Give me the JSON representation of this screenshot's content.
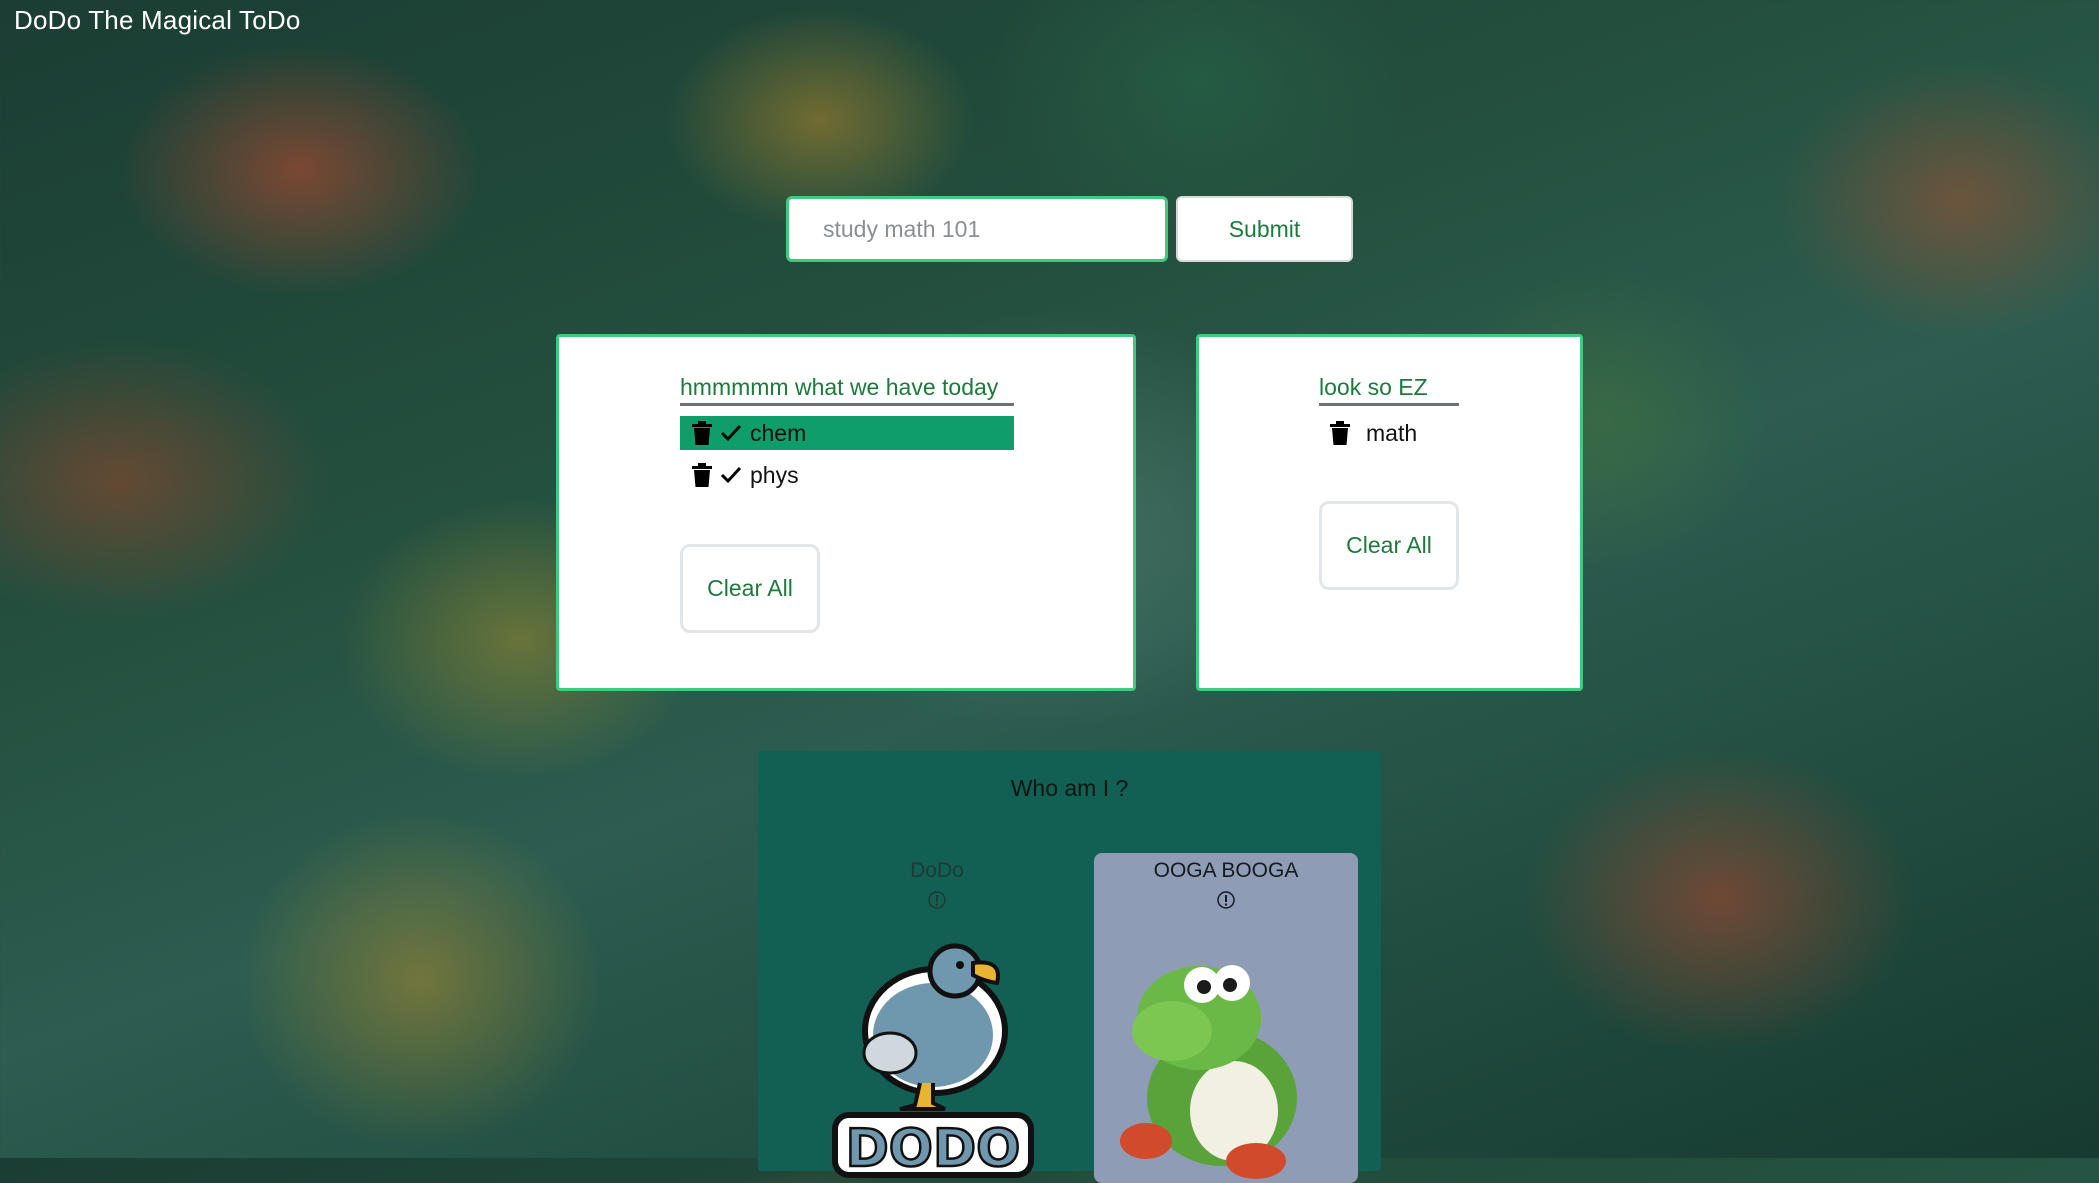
{
  "app": {
    "title": "DoDo The Magical ToDo"
  },
  "form": {
    "input_placeholder": "study math 101",
    "submit_label": "Submit"
  },
  "lists": [
    {
      "heading": "hmmmmm what we have today",
      "items": [
        {
          "text": "chem",
          "highlighted": true
        },
        {
          "text": "phys",
          "highlighted": false
        }
      ],
      "clear_label": "Clear All"
    },
    {
      "heading": "look so EZ",
      "items": [
        {
          "text": "math"
        }
      ],
      "clear_label": "Clear All"
    }
  ],
  "who": {
    "title": "Who am I ?",
    "characters": [
      {
        "name": "DoDo",
        "logo_text": "DODO",
        "icon": "info-icon"
      },
      {
        "name": "OOGA BOOGA",
        "icon": "info-icon"
      }
    ]
  },
  "colors": {
    "accent_green": "#3ecb7e",
    "text_green": "#1d7a3c",
    "highlight": "#109d6c",
    "panel": "#125f54",
    "selected_card": "#8e9db5"
  },
  "icons": {
    "delete": "trash-icon",
    "complete": "check-icon",
    "info": "info-icon"
  }
}
